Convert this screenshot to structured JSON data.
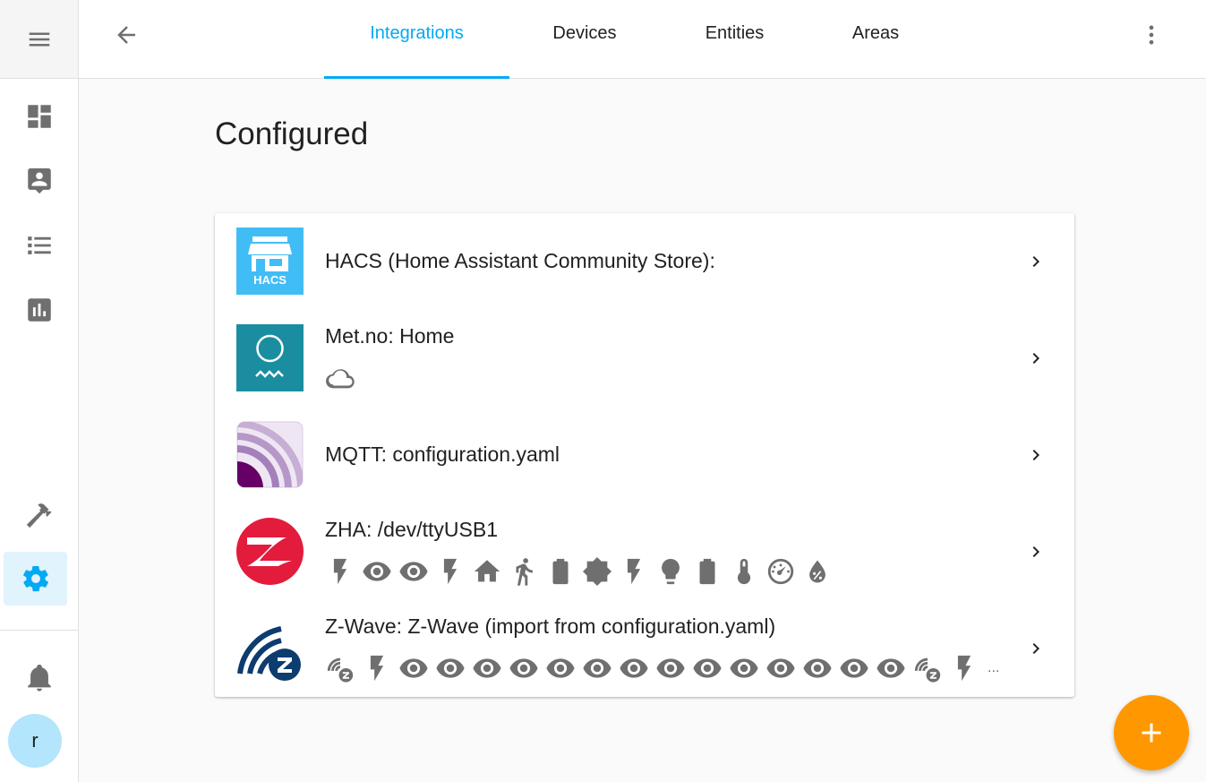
{
  "sidebar": {
    "menu_icon": "menu-icon",
    "items": [
      {
        "icon": "dashboard-icon",
        "selected": false
      },
      {
        "icon": "account-box-icon",
        "selected": false
      },
      {
        "icon": "list-icon",
        "selected": false
      },
      {
        "icon": "chart-box-icon",
        "selected": false
      },
      {
        "icon": "hammer-icon",
        "selected": false
      },
      {
        "icon": "cog-icon",
        "selected": true
      }
    ],
    "notifications_icon": "bell-icon",
    "user_initial": "r"
  },
  "header": {
    "back_icon": "arrow-left-icon",
    "tabs": [
      {
        "label": "Integrations",
        "active": true
      },
      {
        "label": "Devices",
        "active": false
      },
      {
        "label": "Entities",
        "active": false
      },
      {
        "label": "Areas",
        "active": false
      }
    ],
    "overflow_icon": "dots-vertical-icon"
  },
  "main": {
    "title": "Configured",
    "integrations": [
      {
        "title": "HACS (Home Assistant Community Store):",
        "logo": "hacs-logo",
        "logo_text": "HACS",
        "entities": []
      },
      {
        "title": "Met.no: Home",
        "logo": "met-no-logo",
        "entities": [
          "weather-cloudy-icon"
        ]
      },
      {
        "title": "MQTT: configuration.yaml",
        "logo": "mqtt-logo",
        "entities": []
      },
      {
        "title": "ZHA: /dev/ttyUSB1",
        "logo": "zha-logo",
        "entities": [
          "flash-icon",
          "eye-icon",
          "eye-icon",
          "flash-icon",
          "home-icon",
          "walk-icon",
          "battery-icon",
          "brightness-icon",
          "flash-icon",
          "lightbulb-icon",
          "battery-icon",
          "thermometer-icon",
          "gauge-icon",
          "water-percent-icon"
        ]
      },
      {
        "title": "Z-Wave: Z-Wave (import from configuration.yaml)",
        "logo": "zwave-logo",
        "entities": [
          "z-wave-icon",
          "flash-icon",
          "eye-icon",
          "eye-icon",
          "eye-icon",
          "eye-icon",
          "eye-icon",
          "eye-icon",
          "eye-icon",
          "eye-icon",
          "eye-icon",
          "eye-icon",
          "eye-icon",
          "eye-icon",
          "eye-icon",
          "eye-icon",
          "z-wave-icon",
          "flash-icon"
        ],
        "more": "..."
      }
    ]
  },
  "fab": {
    "icon": "plus-icon"
  },
  "colors": {
    "accent": "#03a9f4",
    "fab": "#ff9800",
    "icon": "#6f6f6f",
    "hacs": "#41bdf5",
    "met": "#1a8ea0",
    "zha": "#e31b3c",
    "zwave": "#0d3c6e",
    "mqtt": "#660066"
  }
}
